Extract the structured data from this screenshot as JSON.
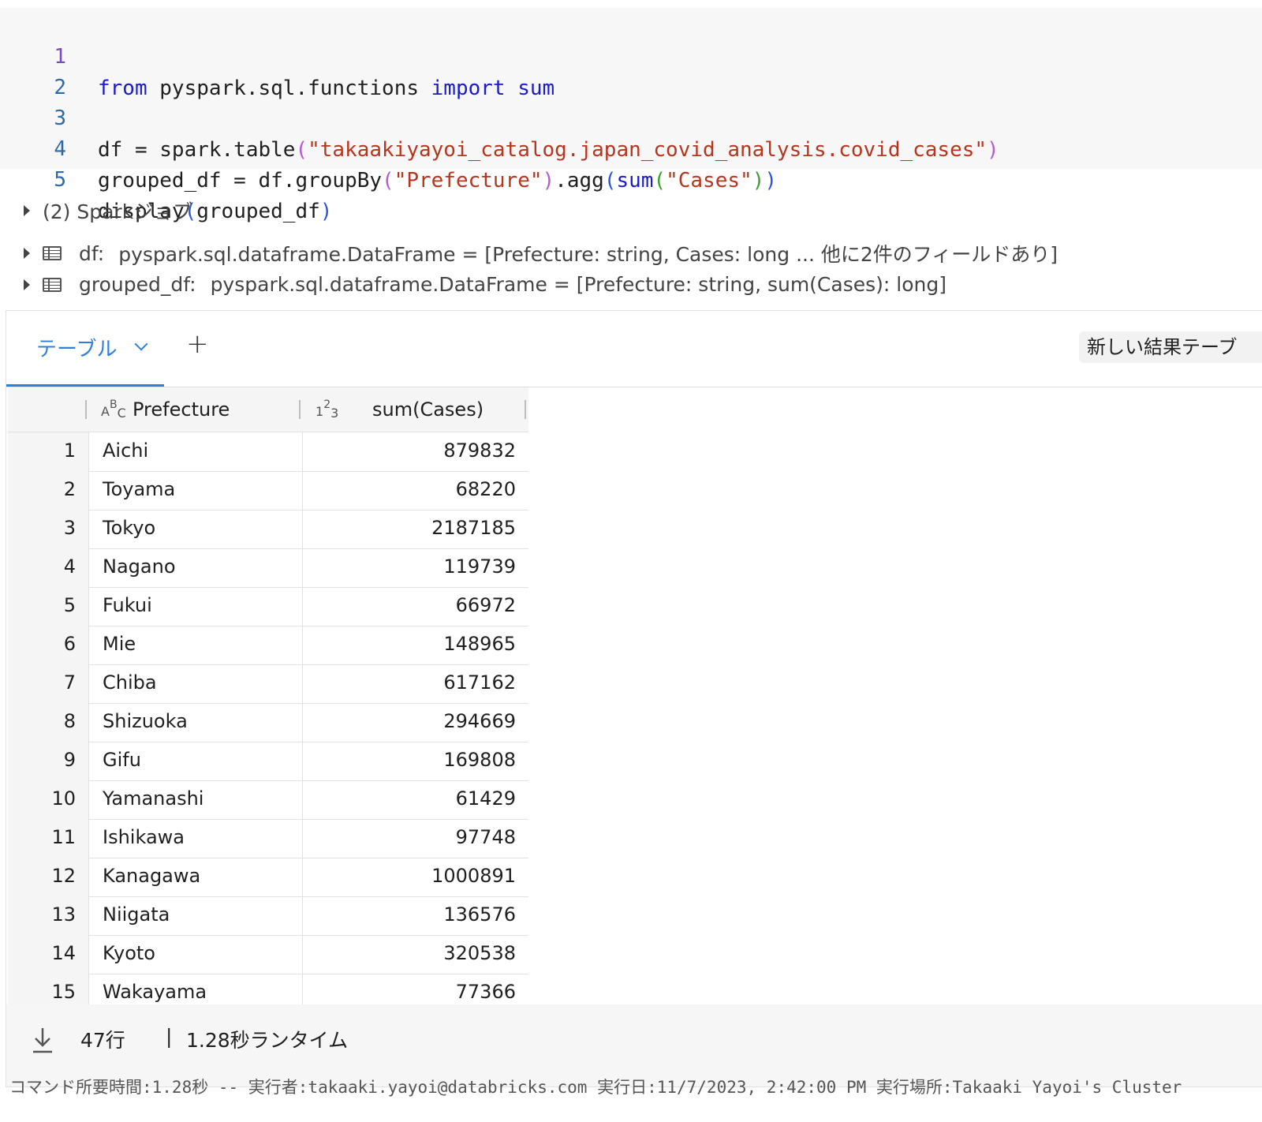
{
  "code": {
    "line_numbers": [
      "1",
      "2",
      "3",
      "4",
      "5"
    ],
    "line1": {
      "kw_from": "from",
      "module": " pyspark.sql.functions ",
      "kw_import": "import",
      "name_sum": " sum"
    },
    "line3": {
      "prefix": "df = spark.table",
      "open": "(",
      "string": "\"takaakiyayoi_catalog.japan_covid_analysis.covid_cases\"",
      "close": ")"
    },
    "line4": {
      "prefix": "grouped_df = df.groupBy",
      "open1": "(",
      "string1": "\"Prefecture\"",
      "close1": ")",
      "mid": ".agg",
      "open2": "(",
      "fn": "sum",
      "open3": "(",
      "string2": "\"Cases\"",
      "close3": ")",
      "close2": ")"
    },
    "line5": {
      "prefix": "display",
      "open": "(",
      "arg": "grouped_df",
      "close": ")"
    }
  },
  "spark_jobs": {
    "label": "(2) Sparkジョブ"
  },
  "schemas": [
    {
      "name": "df:",
      "type": "pyspark.sql.dataframe.DataFrame = [Prefecture: string, Cases: long ... 他に2件のフィールドあり]"
    },
    {
      "name": "grouped_df:",
      "type": "pyspark.sql.dataframe.DataFrame = [Prefecture: string, sum(Cases): long]"
    }
  ],
  "result": {
    "tab_label": "テーブル",
    "new_table_label": "新しい結果テーブ",
    "columns": [
      {
        "type_icon": "ABC",
        "name": "Prefecture"
      },
      {
        "type_icon": "123",
        "name": "sum(Cases)"
      }
    ],
    "rows": [
      {
        "idx": "1",
        "prefecture": "Aichi",
        "cases": "879832"
      },
      {
        "idx": "2",
        "prefecture": "Toyama",
        "cases": "68220"
      },
      {
        "idx": "3",
        "prefecture": "Tokyo",
        "cases": "2187185"
      },
      {
        "idx": "4",
        "prefecture": "Nagano",
        "cases": "119739"
      },
      {
        "idx": "5",
        "prefecture": "Fukui",
        "cases": "66972"
      },
      {
        "idx": "6",
        "prefecture": "Mie",
        "cases": "148965"
      },
      {
        "idx": "7",
        "prefecture": "Chiba",
        "cases": "617162"
      },
      {
        "idx": "8",
        "prefecture": "Shizuoka",
        "cases": "294669"
      },
      {
        "idx": "9",
        "prefecture": "Gifu",
        "cases": "169808"
      },
      {
        "idx": "10",
        "prefecture": "Yamanashi",
        "cases": "61429"
      },
      {
        "idx": "11",
        "prefecture": "Ishikawa",
        "cases": "97748"
      },
      {
        "idx": "12",
        "prefecture": "Kanagawa",
        "cases": "1000891"
      },
      {
        "idx": "13",
        "prefecture": "Niigata",
        "cases": "136576"
      },
      {
        "idx": "14",
        "prefecture": "Kyoto",
        "cases": "320538"
      },
      {
        "idx": "15",
        "prefecture": "Wakayama",
        "cases": "77366"
      }
    ],
    "footer": {
      "row_count": "47行",
      "separator": "|",
      "runtime": "1.28秒ランタイム"
    }
  },
  "status_line": "コマンド所要時間:1.28秒 -- 実行者:takaaki.yayoi@databricks.com 実行日:11/7/2023, 2:42:00 PM 実行場所:Takaaki Yayoi's Cluster",
  "colors": {
    "accent": "#2f7fd8",
    "keyword": "#1a1acc",
    "string": "#b5361e"
  }
}
